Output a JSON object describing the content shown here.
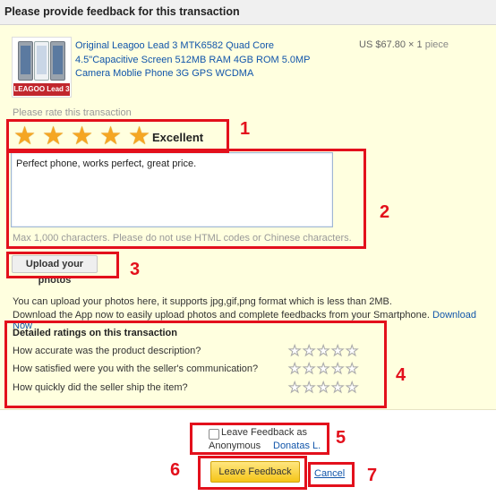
{
  "header": {
    "title": "Please provide feedback for this transaction"
  },
  "product": {
    "thumbnail_brand": "LEAGOO Lead 3",
    "title_line1": "Original Leagoo Lead 3 MTK6582 Quad Core",
    "title_line2": "4.5\"Capacitive Screen 512MB RAM 4GB ROM 5.0MP",
    "title_line3": "Camera Moblie Phone 3G GPS WCDMA",
    "price": "US $67.80",
    "quantity": "× 1",
    "unit": "piece"
  },
  "rating": {
    "label": "Please rate this transaction",
    "stars_filled": 5,
    "stars_total": 5,
    "star_glyph": "★",
    "word": "Excellent",
    "star_color": "#f5a623"
  },
  "comment": {
    "value": "Perfect phone, works perfect, great price.",
    "hint": "Max 1,000 characters. Please do not use HTML codes or Chinese characters."
  },
  "upload": {
    "button_label": "Upload your photos",
    "info_line1": "You can upload your photos here, it supports jpg,gif,png format which is less than 2MB.",
    "info_line2": "Download the App now to easily upload photos and complete feedbacks from your Smartphone.",
    "download_link": "Download Now"
  },
  "detailed": {
    "title": "Detailed ratings on this transaction",
    "questions": [
      {
        "text": "How accurate was the product description?",
        "stars": 0
      },
      {
        "text": "How satisfied were you with the seller's communication?",
        "stars": 0
      },
      {
        "text": "How quickly did the seller ship the item?",
        "stars": 0
      }
    ],
    "star_glyph": "★"
  },
  "anonymous": {
    "label_line1": "Leave Feedback as",
    "label_line2": "Anonymous",
    "name": "Donatas L.",
    "checked": false
  },
  "actions": {
    "leave_feedback": "Leave Feedback",
    "cancel": "Cancel"
  },
  "annotations": {
    "n1": "1",
    "n2": "2",
    "n3": "3",
    "n4": "4",
    "n5": "5",
    "n6": "6",
    "n7": "7",
    "color": "#e3101c"
  }
}
